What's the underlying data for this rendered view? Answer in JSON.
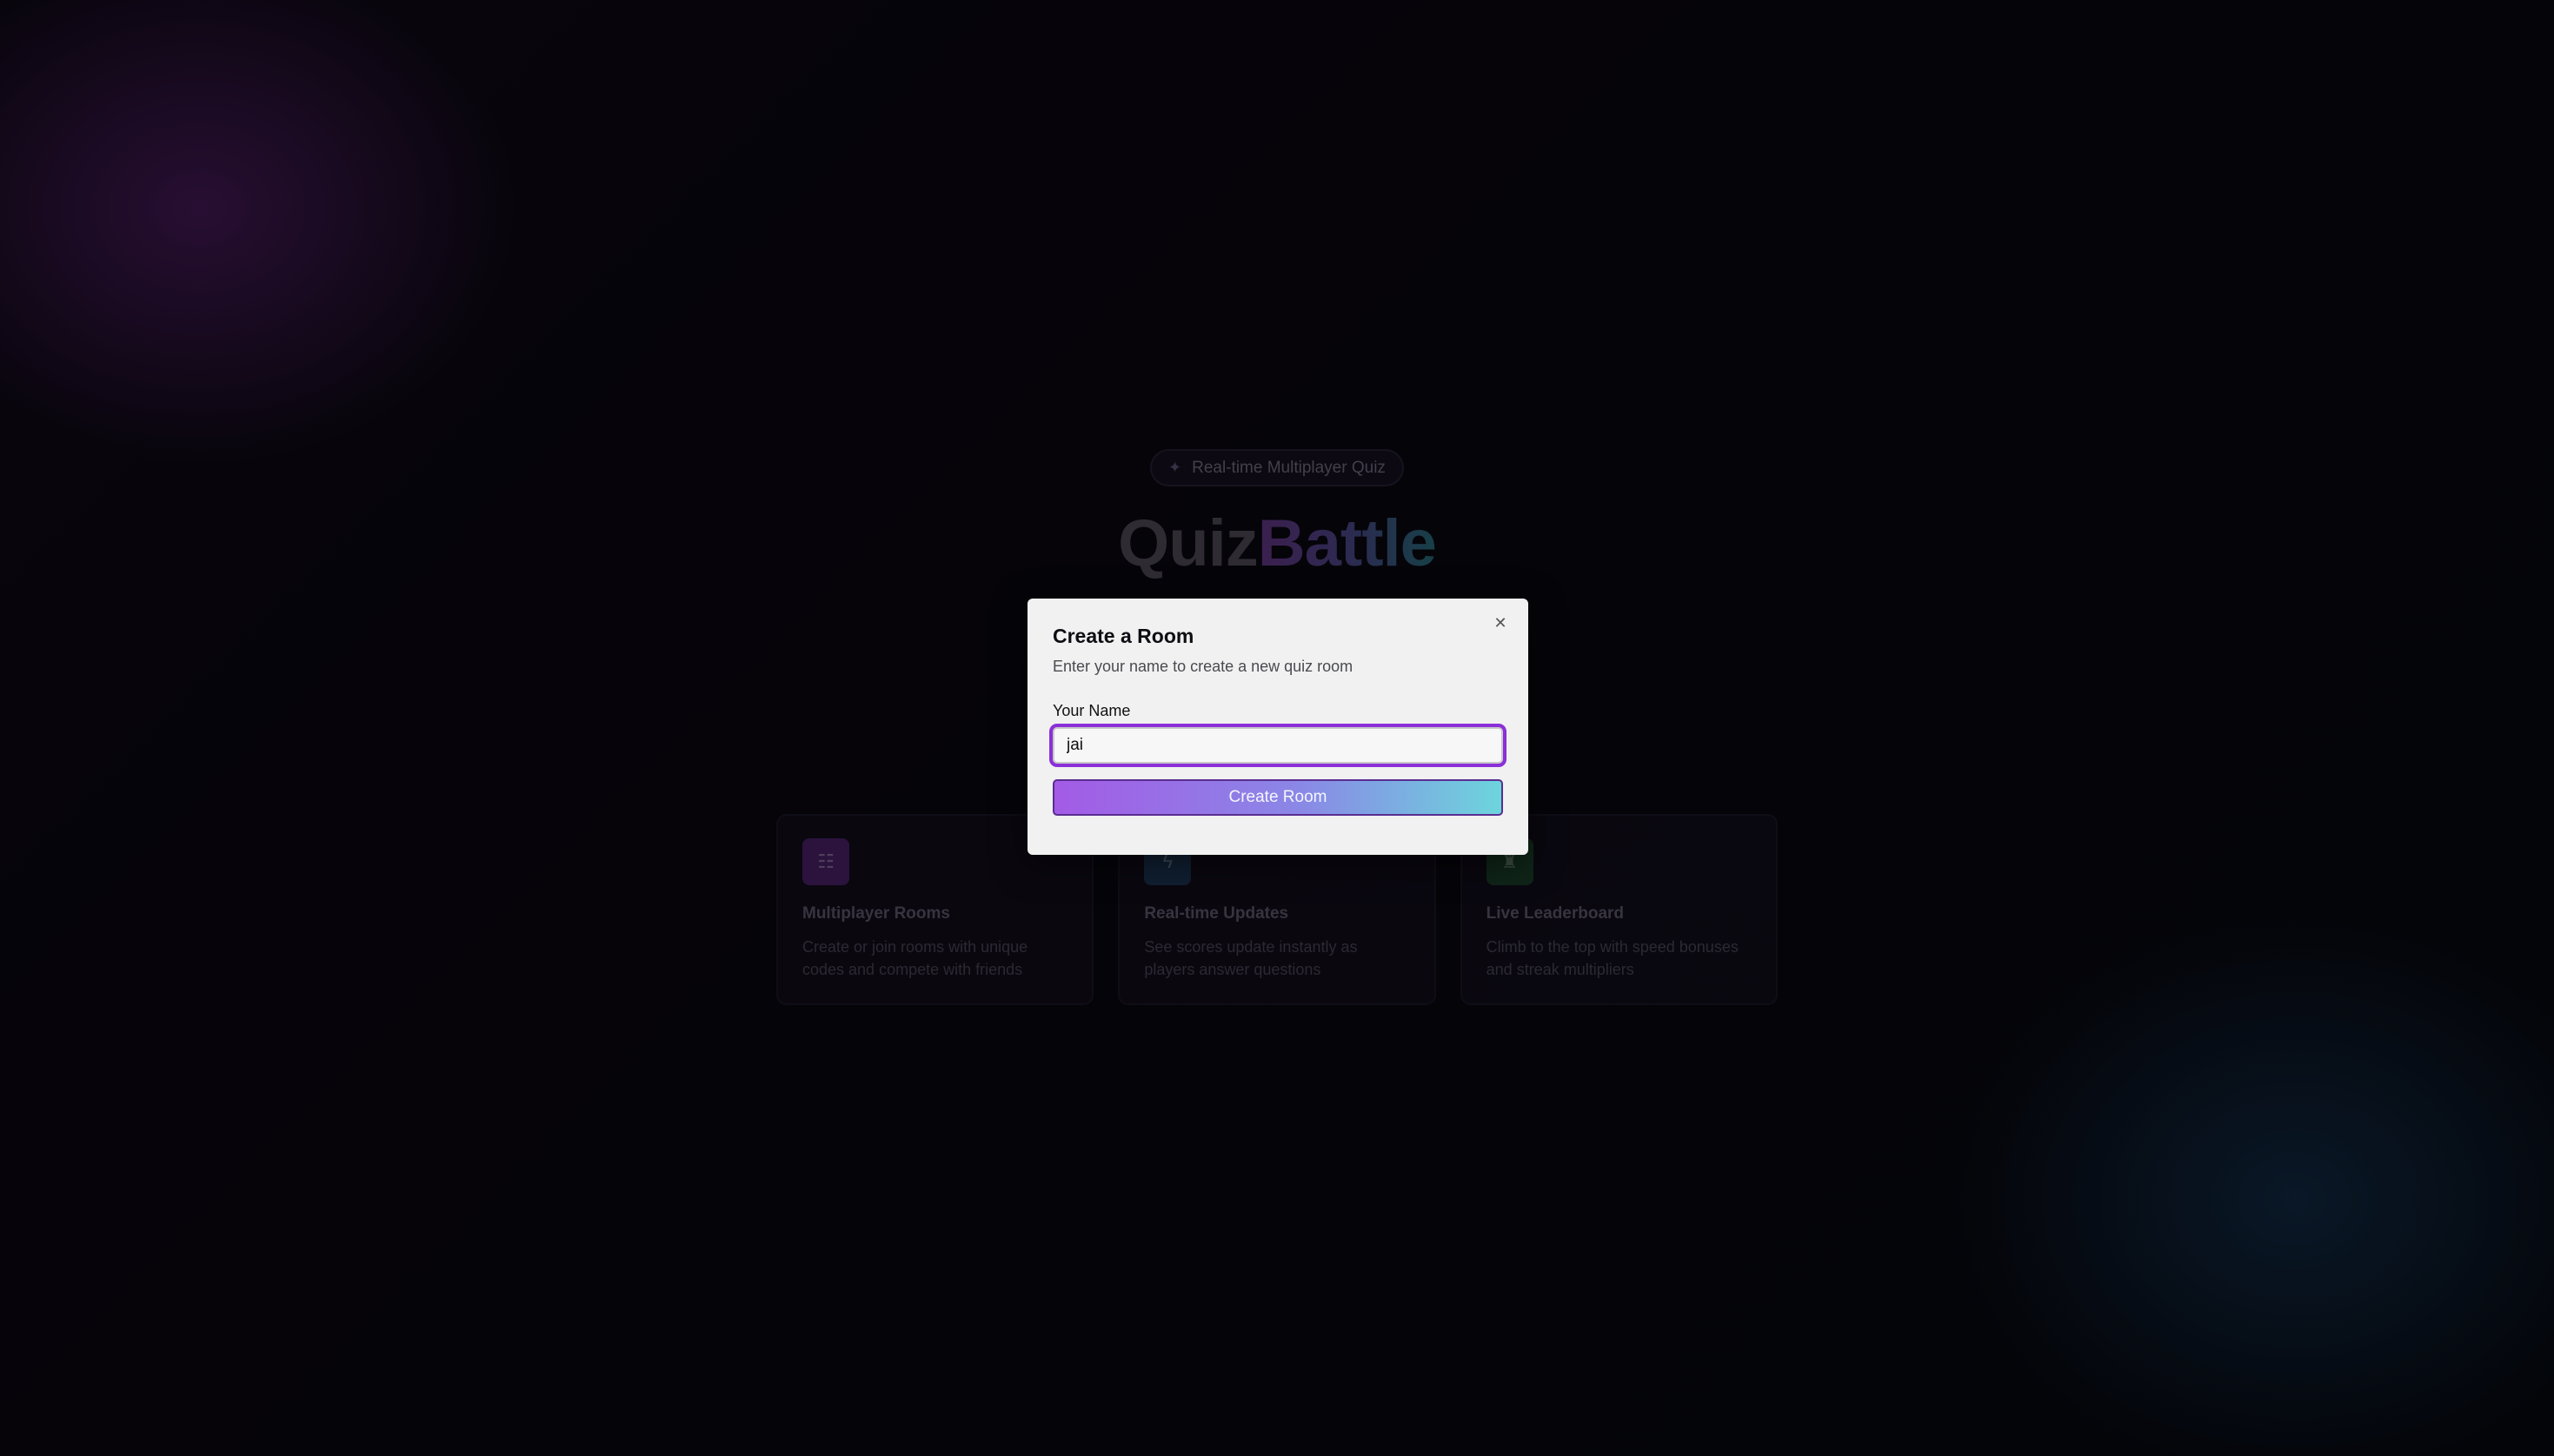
{
  "landing": {
    "badge": {
      "icon": "sparkle-icon",
      "label": "Real-time Multiplayer Quiz"
    },
    "brand": {
      "part1": "Quiz",
      "part2": "Battle"
    },
    "features": [
      {
        "icon": "users-icon",
        "title": "Multiplayer Rooms",
        "description": "Create or join rooms with unique codes and compete with friends"
      },
      {
        "icon": "lightning-icon",
        "title": "Real-time Updates",
        "description": "See scores update instantly as players answer questions"
      },
      {
        "icon": "trophy-icon",
        "title": "Live Leaderboard",
        "description": "Climb to the top with speed bonuses and streak multipliers"
      }
    ]
  },
  "modal": {
    "title": "Create a Room",
    "description": "Enter your name to create a new quiz room",
    "name_label": "Your Name",
    "name_value": "jai",
    "submit_label": "Create Room",
    "close_icon": "close-icon"
  },
  "colors": {
    "accent_purple": "#8b2fd9",
    "gradient_start": "#a35be6",
    "gradient_end": "#6cd5dc"
  }
}
